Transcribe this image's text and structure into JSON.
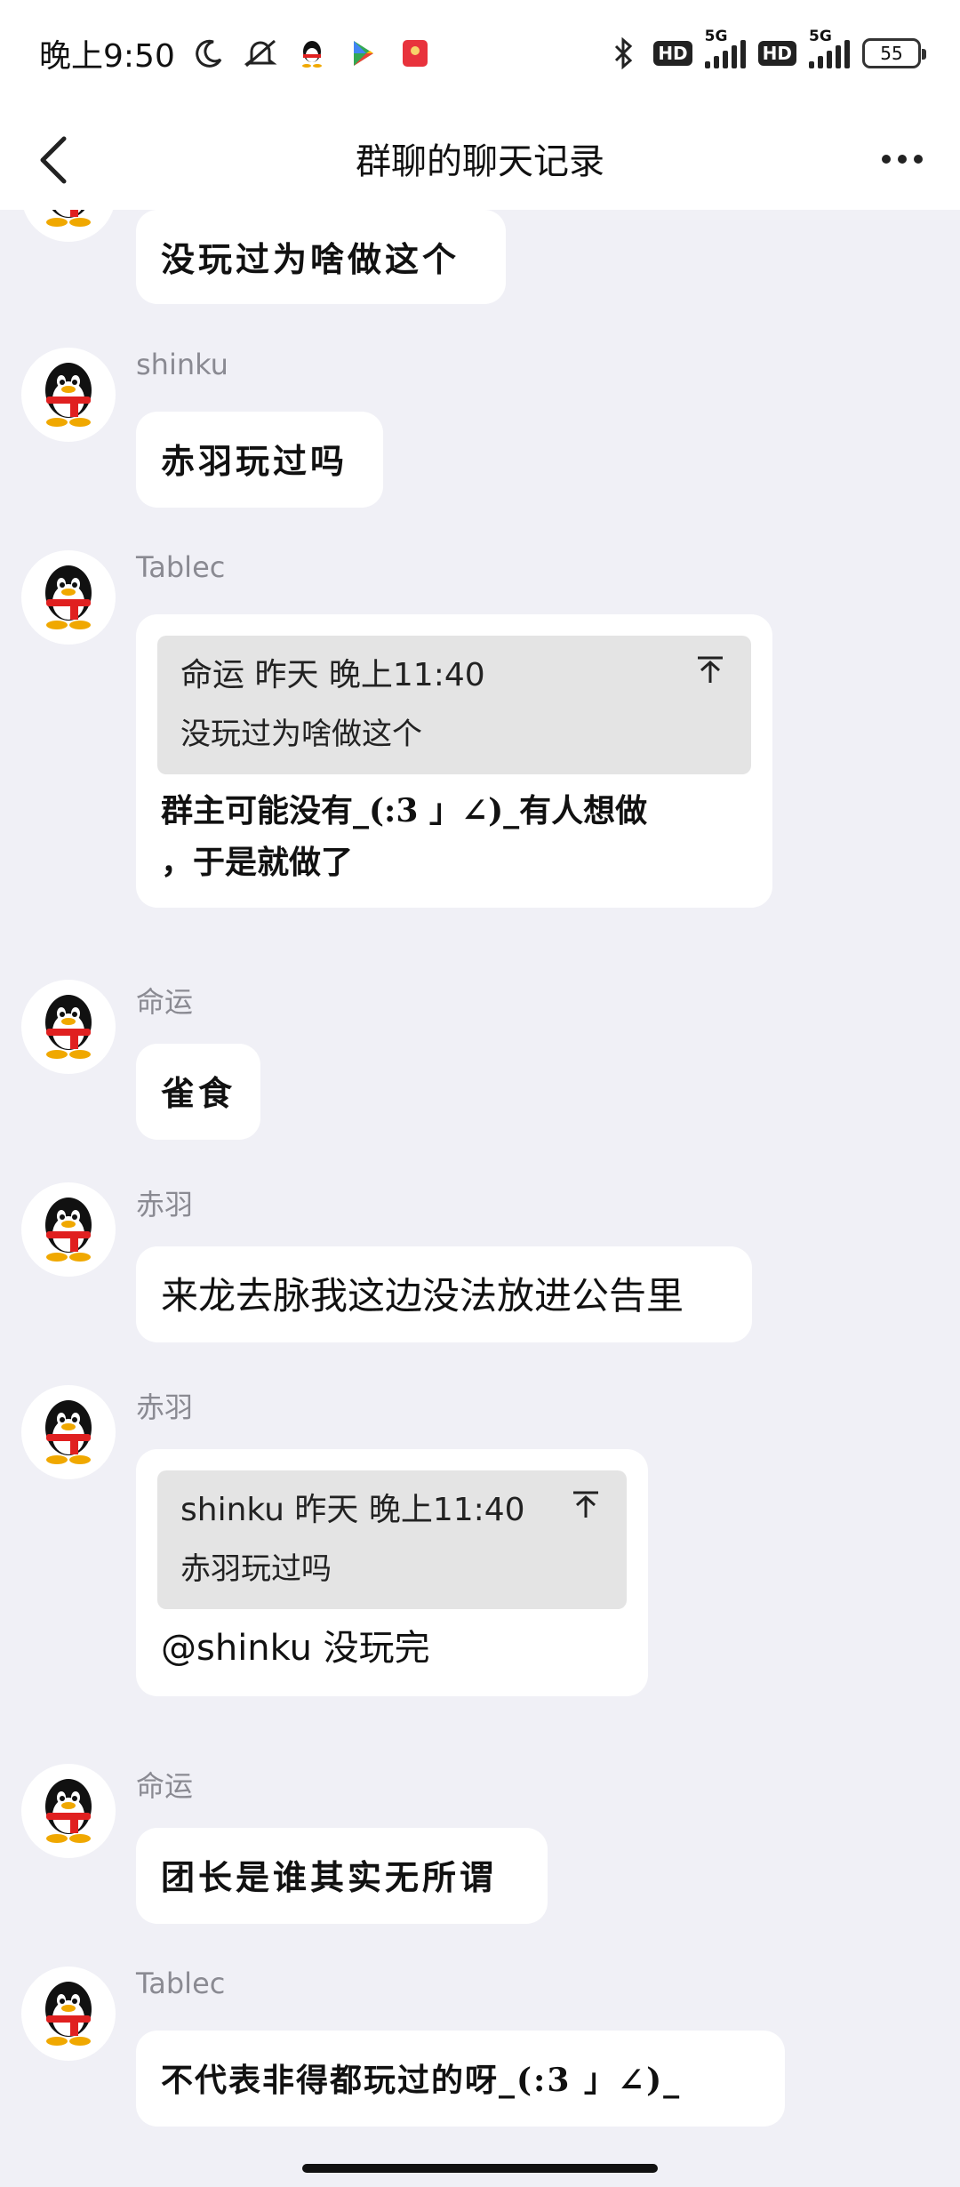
{
  "status_bar": {
    "time": "晚上9:50",
    "battery": "55",
    "network_1": "5G",
    "network_2": "5G",
    "hd": "HD",
    "icons": [
      "moon-icon",
      "mute-icon",
      "qq-icon",
      "play-store-icon",
      "red-packet-icon",
      "bluetooth-icon"
    ]
  },
  "nav": {
    "title": "群聊的聊天记录"
  },
  "messages": [
    {
      "sender": "",
      "text": "没玩过为啥做这个"
    },
    {
      "sender": "shinku",
      "text": "赤羽玩过吗"
    },
    {
      "sender": "Tablec",
      "quote_head": "命运 昨天 晚上11:40",
      "quote_text": "没玩过为啥做这个",
      "text": "群主可能没有_(:3 」∠)_有人想做\n，于是就做了"
    },
    {
      "sender": "命运",
      "text": "雀食"
    },
    {
      "sender": "赤羽",
      "text": "来龙去脉我这边没法放进公告里"
    },
    {
      "sender": "赤羽",
      "quote_head": "shinku 昨天 晚上11:40",
      "quote_text": "赤羽玩过吗",
      "text": "@shinku 没玩完"
    },
    {
      "sender": "命运",
      "text": "团长是谁其实无所谓"
    },
    {
      "sender": "Tablec",
      "text": "不代表非得都玩过的呀_(:3 」∠)_"
    }
  ]
}
